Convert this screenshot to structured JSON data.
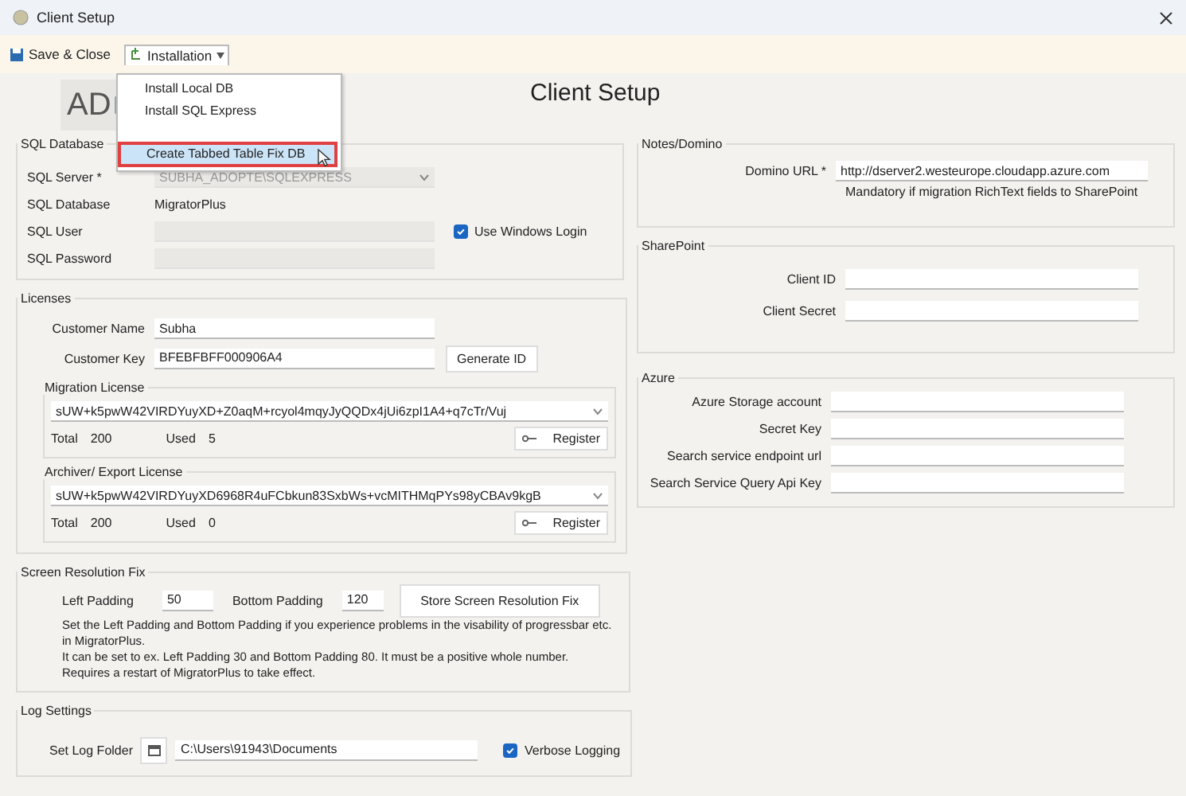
{
  "window": {
    "title": "Client Setup"
  },
  "toolbar": [
    {
      "kind": "save",
      "label": "Save & Close",
      "dropdown": false
    },
    {
      "kind": "install",
      "label": "Installation",
      "dropdown": true
    }
  ],
  "menu": {
    "items": [
      {
        "kind": "item",
        "label": "Install Local DB",
        "selected": false
      },
      {
        "kind": "item",
        "label": "Install SQL Express",
        "selected": false
      },
      {
        "kind": "gap"
      },
      {
        "kind": "item",
        "label": "Create Tabbed Table Fix DB",
        "selected": true
      }
    ]
  },
  "logo": {
    "text": "AD"
  },
  "heading": "Client Setup",
  "sql_database": {
    "title": "SQL Database",
    "rows": [
      {
        "kind": "combo",
        "label": "SQL Server *",
        "value": "SUBHA_ADOPTE\\SQLEXPRESS",
        "disabled": true
      },
      {
        "kind": "text",
        "label": "SQL Database",
        "value": "MigratorPlus"
      },
      {
        "kind": "field",
        "label": "SQL User",
        "value": "",
        "disabled": true,
        "checkbox": {
          "label": "Use Windows Login",
          "checked": true
        }
      },
      {
        "kind": "field",
        "label": "SQL Password",
        "value": "",
        "disabled": true
      }
    ]
  },
  "licenses": {
    "title": "Licenses",
    "customer_name": {
      "label": "Customer Name",
      "value": "Subha"
    },
    "customer_key": {
      "label": "Customer Key",
      "value": "BFEBFBFF000906A4"
    },
    "generate_button": "Generate ID",
    "items": [
      {
        "title": "Migration License",
        "key": "sUW+k5pwW42VIRDYuyXD+Z0aqM+rcyol4mqyJyQQDx4jUi6zpI1A4+q7cTr/Vuj",
        "total_label": "Total",
        "total": "200",
        "used_label": "Used",
        "used": "5",
        "button": "Register"
      },
      {
        "title": "Archiver/ Export License",
        "key": "sUW+k5pwW42VIRDYuyXD6968R4uFCbkun83SxbWs+vcMITHMqPYs98yCBAv9kgB",
        "total_label": "Total",
        "total": "200",
        "used_label": "Used",
        "used": "0",
        "button": "Register"
      }
    ]
  },
  "screen_fix": {
    "title": "Screen Resolution Fix",
    "left_padding": {
      "label": "Left Padding",
      "value": "50"
    },
    "bottom_padding": {
      "label": "Bottom Padding",
      "value": "120"
    },
    "button": "Store Screen Resolution Fix",
    "notes": [
      "Set the Left Padding and Bottom Padding if you experience problems in the visability of progressbar etc. in MigratorPlus.",
      "It can be set to ex. Left Padding 30 and Bottom Padding 80. It must be a positive whole number.",
      "Requires a restart of MigratorPlus to take effect."
    ]
  },
  "log_settings": {
    "title": "Log Settings",
    "label": "Set Log Folder",
    "path": "C:\\Users\\91943\\Documents",
    "checkbox": {
      "label": "Verbose Logging",
      "checked": true
    }
  },
  "notes_domino": {
    "title": "Notes/Domino",
    "label": "Domino URL *",
    "value": "http://dserver2.westeurope.cloudapp.azure.com",
    "hint": "Mandatory if migration RichText fields to SharePoint"
  },
  "sharepoint": {
    "title": "SharePoint",
    "rows": [
      {
        "label": "Client ID",
        "value": ""
      },
      {
        "label": "Client Secret",
        "value": ""
      }
    ]
  },
  "azure": {
    "title": "Azure",
    "rows": [
      {
        "label": "Azure Storage account",
        "value": ""
      },
      {
        "label": "Secret Key",
        "value": ""
      },
      {
        "label": "Search service endpoint url",
        "value": ""
      },
      {
        "label": "Search Service Query Api Key",
        "value": ""
      }
    ]
  }
}
